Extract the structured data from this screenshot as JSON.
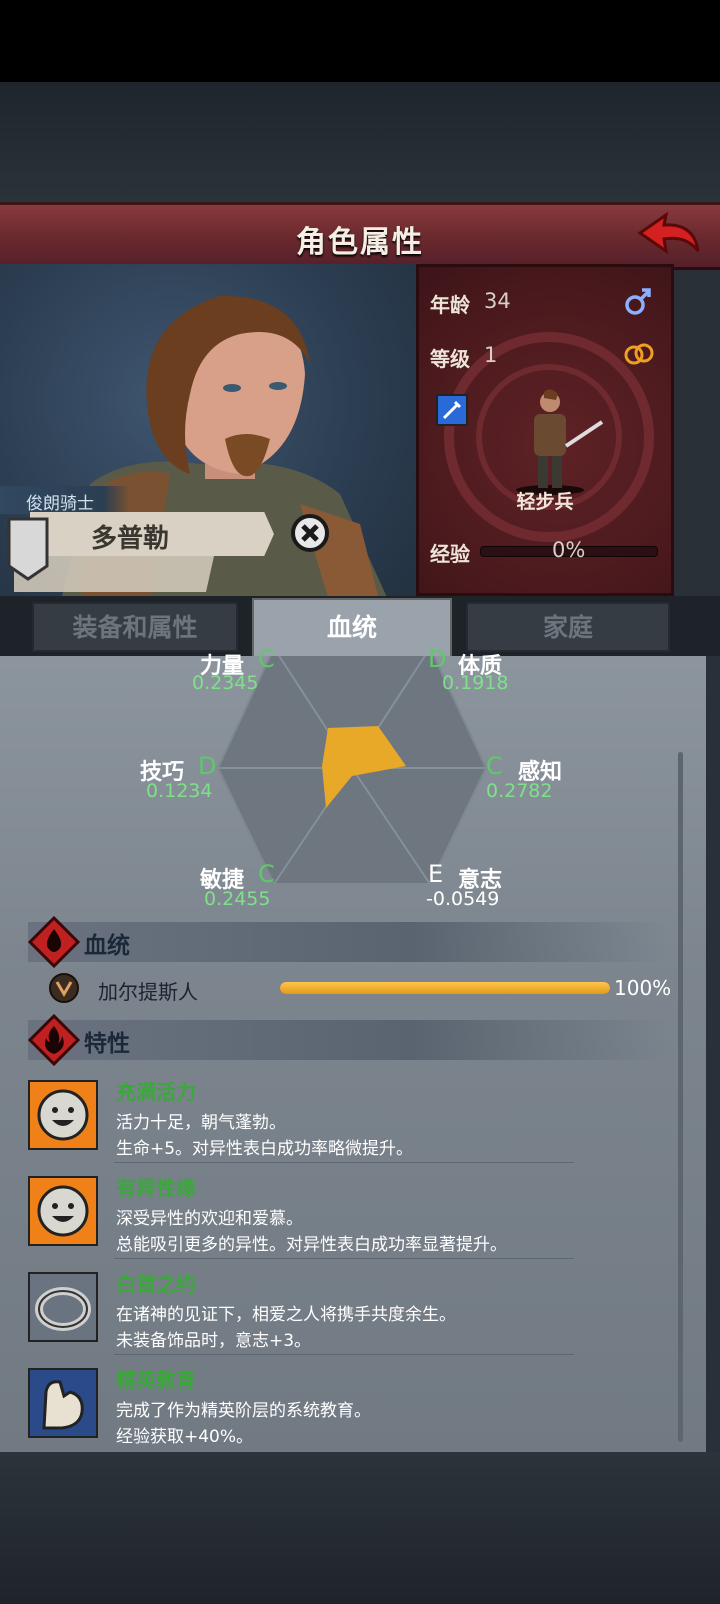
{
  "header": {
    "title": "角色属性",
    "back_icon": "back-arrow-icon"
  },
  "character": {
    "title": "俊朗骑士",
    "name": "多普勒",
    "age_label": "年龄",
    "age": "34",
    "level_label": "等级",
    "level": "1",
    "unit": "轻步兵",
    "exp_label": "经验",
    "exp_percent": "0%",
    "exp_fraction": 0
  },
  "tabs": [
    {
      "label": "装备和属性",
      "active": false
    },
    {
      "label": "血统",
      "active": true
    },
    {
      "label": "家庭",
      "active": false
    }
  ],
  "stats": {
    "strength": {
      "name": "力量",
      "grade": "C",
      "value": "0.2345"
    },
    "constitution": {
      "name": "体质",
      "grade": "D",
      "value": "0.1918"
    },
    "skill": {
      "name": "技巧",
      "grade": "D",
      "value": "0.1234"
    },
    "perception": {
      "name": "感知",
      "grade": "C",
      "value": "0.2782"
    },
    "agility": {
      "name": "敏捷",
      "grade": "C",
      "value": "0.2455"
    },
    "will": {
      "name": "意志",
      "grade": "E",
      "value": "-0.0549"
    }
  },
  "bloodline": {
    "section_title": "血统",
    "items": [
      {
        "name": "加尔提斯人",
        "percent": "100%",
        "fraction": 1.0
      }
    ]
  },
  "traits": {
    "section_title": "特性",
    "items": [
      {
        "name": "充满活力",
        "line1": "活力十足，朝气蓬勃。",
        "line2": "生命+5。对异性表白成功率略微提升。",
        "icon": "smiley-sun-icon"
      },
      {
        "name": "有异性缘",
        "line1": "深受异性的欢迎和爱慕。",
        "line2": "总能吸引更多的异性。对异性表白成功率显著提升。",
        "icon": "smiley-sun-icon"
      },
      {
        "name": "白首之约",
        "line1": "在诸神的见证下，相爱之人将携手共度余生。",
        "line2": "未装备饰品时，意志+3。",
        "icon": "ring-icon"
      },
      {
        "name": "精英教育",
        "line1": "完成了作为精英阶层的系统教育。",
        "line2": "经验获取+40%。",
        "icon": "flexed-arm-icon"
      }
    ]
  },
  "colors": {
    "banner": "#6b2a2e",
    "grade_green": "#5fc86a",
    "trait_green": "#3aa83a",
    "bar_orange": "#f0a830"
  }
}
